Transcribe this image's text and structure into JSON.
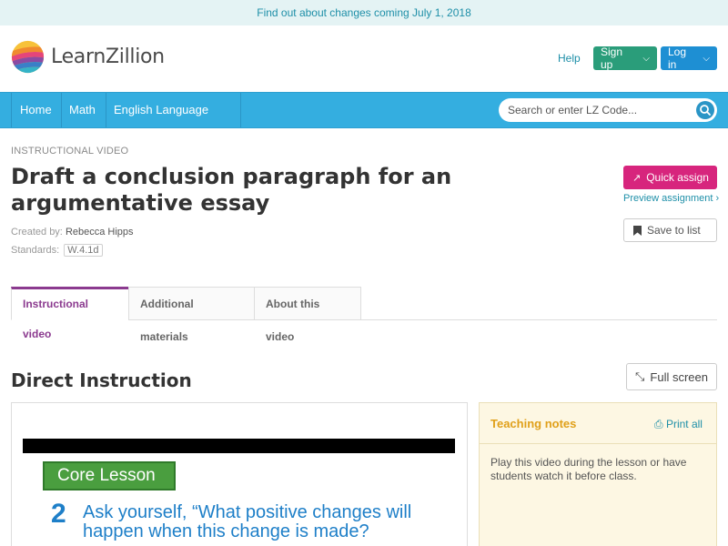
{
  "announcement": "Find out about changes coming July 1, 2018",
  "brand": {
    "name": "LearnZillion"
  },
  "header": {
    "help": "Help",
    "signup": "Sign up",
    "login": "Log in"
  },
  "nav": {
    "items": [
      {
        "label": "Home"
      },
      {
        "label": "Math"
      },
      {
        "label": "English Language Arts"
      }
    ],
    "search_placeholder": "Search or enter LZ Code..."
  },
  "lesson": {
    "type": "INSTRUCTIONAL VIDEO",
    "title": "Draft a conclusion paragraph for an argumentative essay",
    "created_by_label": "Created by:",
    "created_by": "Rebecca Hipps",
    "standards_label": "Standards:",
    "standard": "W.4.1d"
  },
  "actions": {
    "quick_assign": "Quick assign",
    "preview": "Preview assignment ›",
    "save": "Save to list"
  },
  "tabs": [
    {
      "label": "Instructional video"
    },
    {
      "label": "Additional materials"
    },
    {
      "label": "About this video"
    }
  ],
  "section": {
    "title": "Direct Instruction",
    "fullscreen": "Full screen"
  },
  "video": {
    "badge": "Core Lesson",
    "number": "2",
    "question": "Ask yourself, “What positive changes will happen when this change is made?"
  },
  "notes": {
    "title": "Teaching notes",
    "print": "Print all",
    "body": "Play this video during the lesson or have students watch it before class."
  },
  "colors": {
    "brand_blue": "#34aee0",
    "signup_green": "#2a9d7a",
    "login_blue": "#1e8fd3",
    "assign_pink": "#d7257d",
    "tab_purple": "#8b3a8f",
    "notes_gold": "#e0a01a"
  }
}
